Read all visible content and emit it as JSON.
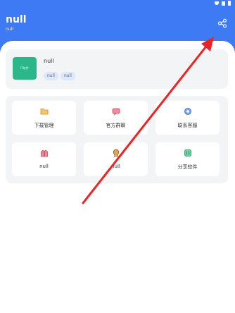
{
  "header": {
    "title": "null",
    "subtitle": "null"
  },
  "profile": {
    "logo_text": "IT软件",
    "name": "null",
    "tags": [
      "null",
      "null"
    ]
  },
  "grid": [
    {
      "label": "下载管理",
      "icon": "folder-icon"
    },
    {
      "label": "官方群聊",
      "icon": "chat-icon"
    },
    {
      "label": "联系客服",
      "icon": "gear-icon"
    },
    {
      "label": "null",
      "icon": "gift-icon"
    },
    {
      "label": "null",
      "icon": "badge-icon"
    },
    {
      "label": "分享软件",
      "icon": "share-app-icon"
    }
  ],
  "colors": {
    "header": "#3d7af3",
    "logo": "#2bb78a",
    "card": "#f3f4f6",
    "arrow": "#ee2222"
  }
}
